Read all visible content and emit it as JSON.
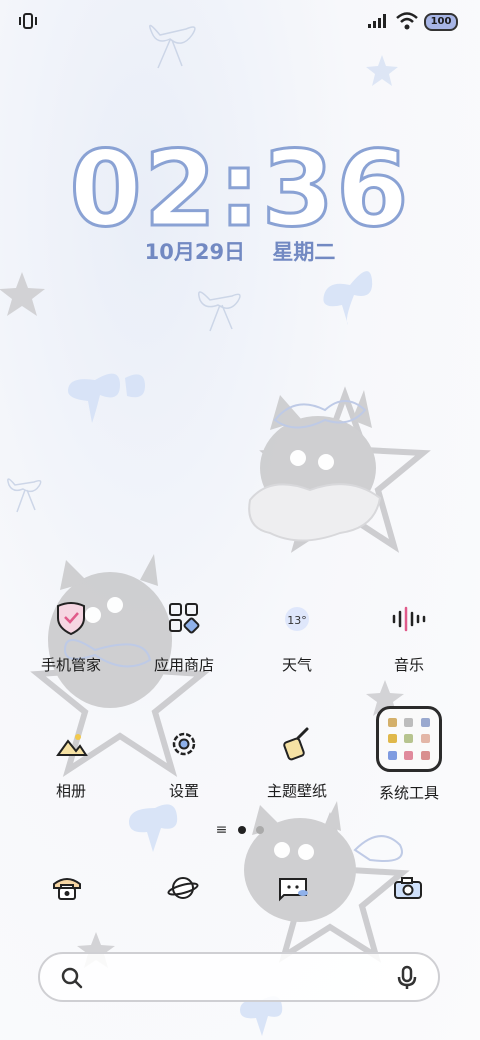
{
  "status_bar": {
    "battery": "100"
  },
  "clock": {
    "time": "02:36",
    "date": "10月29日",
    "weekday": "星期二"
  },
  "apps": [
    {
      "label": "手机管家",
      "icon": "shield-icon"
    },
    {
      "label": "应用商店",
      "icon": "app-store-icon"
    },
    {
      "label": "天气",
      "icon": "weather-icon",
      "temp": "13°"
    },
    {
      "label": "音乐",
      "icon": "music-icon"
    },
    {
      "label": "相册",
      "icon": "gallery-icon"
    },
    {
      "label": "设置",
      "icon": "gear-icon"
    },
    {
      "label": "主题壁纸",
      "icon": "theme-brush-icon"
    },
    {
      "label": "系统工具",
      "icon": "folder-icon"
    }
  ],
  "dock": [
    {
      "icon": "phone-icon"
    },
    {
      "icon": "browser-planet-icon"
    },
    {
      "icon": "messages-icon"
    },
    {
      "icon": "camera-icon"
    }
  ],
  "search": {
    "icon": "search-icon",
    "mic": "microphone-icon"
  },
  "colors": {
    "accent": "#8aa2d4",
    "date": "#7289c2"
  }
}
